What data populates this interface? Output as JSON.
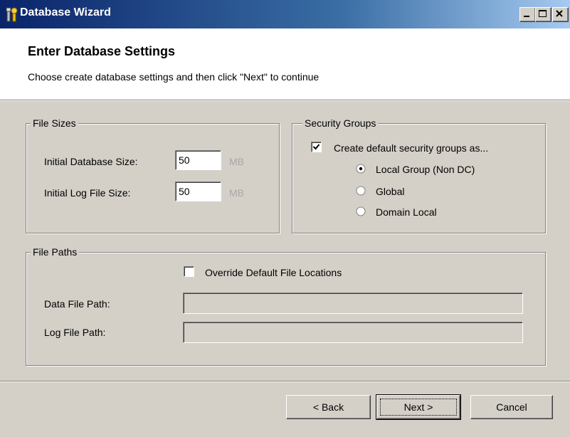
{
  "window": {
    "title": "Database Wizard",
    "controls": [
      "minimize",
      "maximize",
      "close"
    ]
  },
  "header": {
    "title": "Enter Database Settings",
    "subtitle": "Choose create database settings and then click \"Next\" to continue"
  },
  "file_sizes": {
    "legend": "File Sizes",
    "initial_db_label": "Initial Database Size:",
    "initial_db_value": "50",
    "initial_db_unit": "MB",
    "initial_log_label": "Initial Log File Size:",
    "initial_log_value": "50",
    "initial_log_unit": "MB"
  },
  "security_groups": {
    "legend": "Security Groups",
    "create_default_label": "Create default security groups as...",
    "create_default_checked": true,
    "options": [
      {
        "label": "Local Group (Non DC)",
        "selected": true
      },
      {
        "label": "Global",
        "selected": false
      },
      {
        "label": "Domain Local",
        "selected": false
      }
    ]
  },
  "file_paths": {
    "legend": "File Paths",
    "override_label": "Override Default File Locations",
    "override_checked": false,
    "data_path_label": "Data File Path:",
    "data_path_value": "",
    "log_path_label": "Log File Path:",
    "log_path_value": ""
  },
  "buttons": {
    "back": "< Back",
    "next": "Next >",
    "cancel": "Cancel"
  },
  "icons": {
    "app": "wizard-wrench-icon",
    "minimize": "minimize-icon",
    "maximize": "maximize-icon",
    "close": "close-icon"
  },
  "colors": {
    "titlebar_start": "#0a246a",
    "titlebar_end": "#a6caf0",
    "face": "#d4d0c8"
  }
}
